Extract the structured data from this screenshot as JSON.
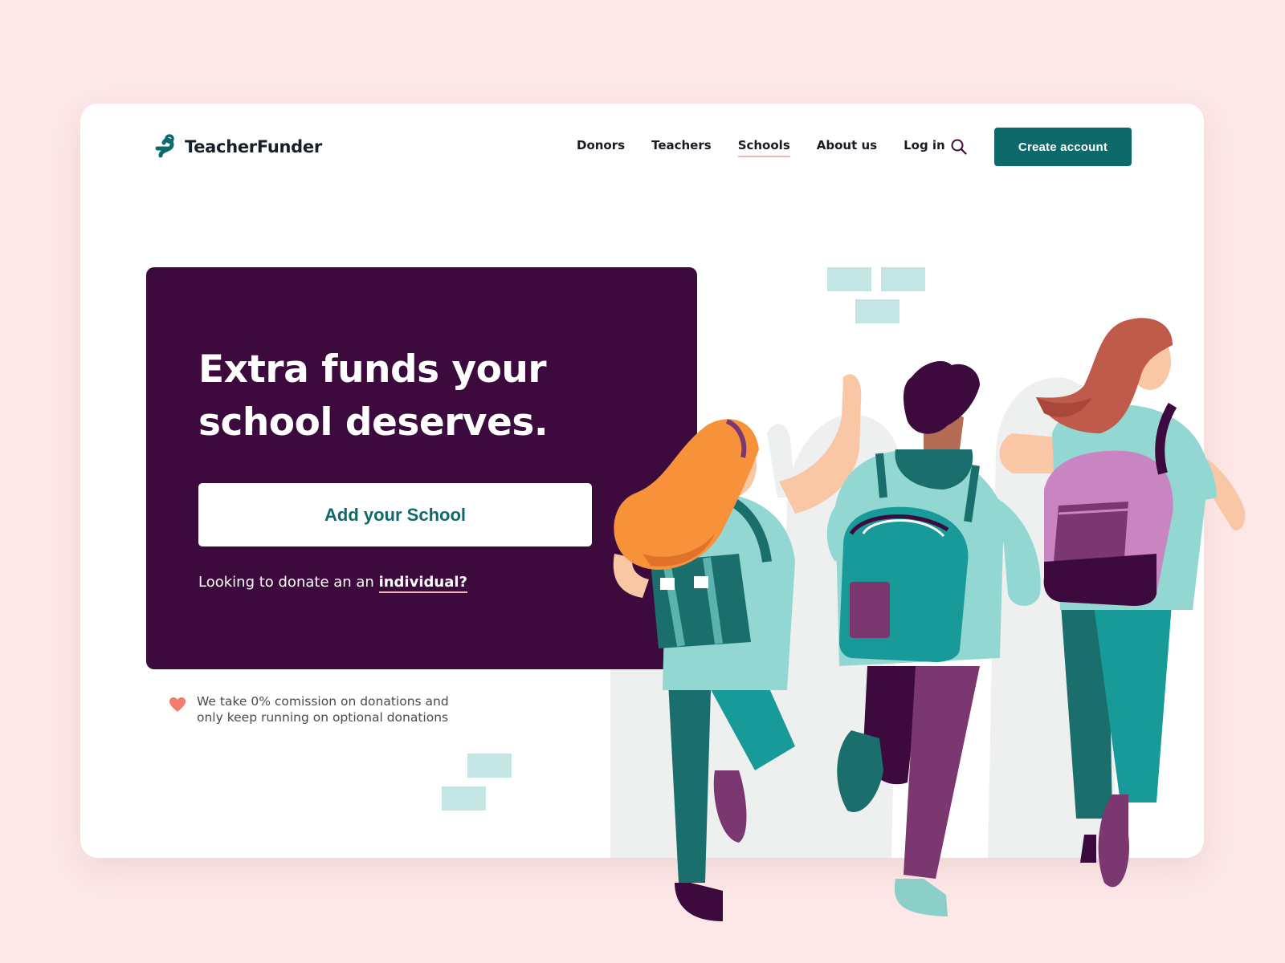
{
  "brand": {
    "name": "TeacherFunder",
    "logo_icon": "teacherfunder-logo-icon"
  },
  "nav": {
    "items": [
      {
        "label": "Donors",
        "active": false
      },
      {
        "label": "Teachers",
        "active": false
      },
      {
        "label": "Schools",
        "active": true
      },
      {
        "label": "About us",
        "active": false
      },
      {
        "label": "Log in",
        "active": false
      }
    ],
    "search_icon": "search-icon",
    "cta_label": "Create account"
  },
  "hero": {
    "title_line1": "Extra funds your",
    "title_line2": "school deserves.",
    "button_label": "Add your School",
    "donate_prefix": "Looking to donate an an ",
    "donate_link": "individual?"
  },
  "note": {
    "icon": "heart-icon",
    "line1": "We take 0% comission on donations and",
    "line2": "only keep running on optional donations"
  },
  "colors": {
    "page_bg": "#fde8e7",
    "accent": "#0e6a6a",
    "hero_bg": "#3d0a3d",
    "underline": "#f4b4b0",
    "heart": "#f27c6d"
  }
}
